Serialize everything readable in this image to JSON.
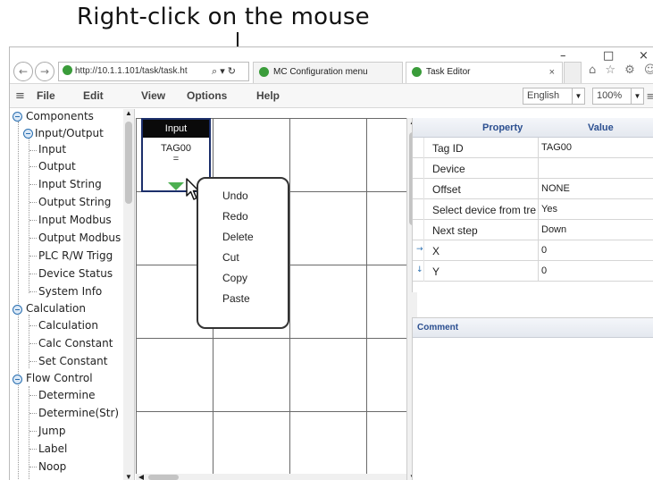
{
  "caption": "Right-click on the mouse",
  "browser": {
    "window_controls": {
      "minimize": "–",
      "maximize": "□",
      "close": "×"
    },
    "back_icon": "←",
    "forward_icon": "→",
    "address": "http://10.1.1.101/task/task.ht",
    "address_icons": "⌕ ▾ ↻",
    "tabs": [
      {
        "label": "MC Configuration menu"
      },
      {
        "label": "Task Editor",
        "close": "×"
      }
    ],
    "toolbar_icons": "⌂ ☆ ⚙ ☺"
  },
  "menubar": {
    "hamburger": "≡",
    "items": [
      "File",
      "Edit",
      "View",
      "Options",
      "Help"
    ],
    "language": "English",
    "zoom": "100%",
    "dropdown_arrow": "▼",
    "more": "≡"
  },
  "tree": {
    "root": "Components",
    "groups": [
      {
        "label": "Input/Output",
        "children": [
          "Input",
          "Output",
          "Input String",
          "Output String",
          "Input Modbus",
          "Output Modbus",
          "PLC R/W Trigg",
          "Device Status",
          "System Info"
        ]
      },
      {
        "label": "Calculation",
        "children": [
          "Calculation",
          "Calc Constant",
          "Set Constant"
        ]
      },
      {
        "label": "Flow Control",
        "children": [
          "Determine",
          "Determine(Str)",
          "Jump",
          "Label",
          "Noop"
        ]
      }
    ]
  },
  "block": {
    "title": "Input",
    "tag": "TAG00",
    "symbol": "="
  },
  "context_menu": [
    "Undo",
    "Redo",
    "Delete",
    "Cut",
    "Copy",
    "Paste"
  ],
  "properties": {
    "header_property": "Property",
    "header_value": "Value",
    "rows": [
      {
        "name": "Tag ID",
        "value": "TAG00",
        "prefix": ""
      },
      {
        "name": "Device",
        "value": "",
        "prefix": ""
      },
      {
        "name": "Offset",
        "value": "NONE",
        "prefix": ""
      },
      {
        "name": "Select device from tre",
        "value": "Yes",
        "prefix": ""
      },
      {
        "name": "Next step",
        "value": "Down",
        "prefix": ""
      },
      {
        "name": "X",
        "value": "0",
        "prefix": "→"
      },
      {
        "name": "Y",
        "value": "0",
        "prefix": "↓"
      }
    ]
  },
  "comment": {
    "title": "Comment"
  },
  "scroll_up": "▲",
  "scroll_down": "▼"
}
